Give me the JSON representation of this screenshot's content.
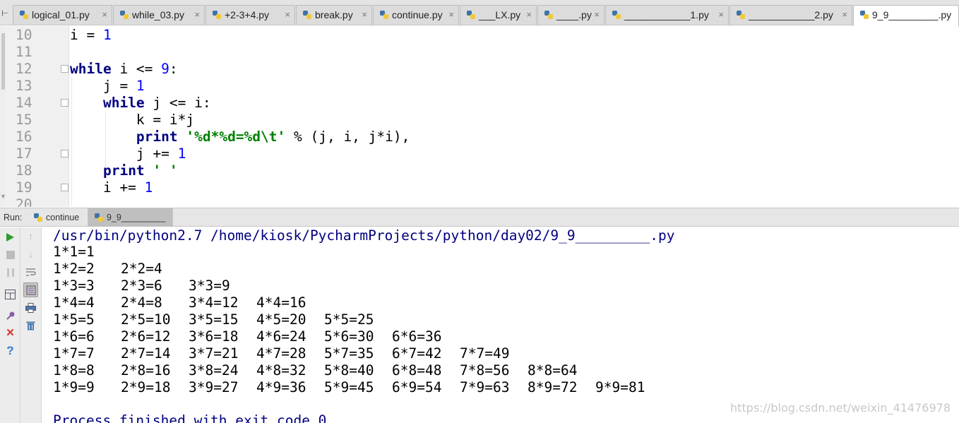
{
  "editor_tabs": [
    {
      "label": "logical_01.py"
    },
    {
      "label": "while_03.py"
    },
    {
      "label": "+2-3+4.py"
    },
    {
      "label": "break.py"
    },
    {
      "label": "continue.py"
    },
    {
      "label": "___LX.py"
    },
    {
      "label": "____.py"
    },
    {
      "label": "____________1.py"
    },
    {
      "label": "____________2.py"
    },
    {
      "label": "9_9_________.py",
      "active": true
    }
  ],
  "tab_close_glyph": "×",
  "code_lines": [
    {
      "num": "10",
      "text": "i = 1"
    },
    {
      "num": "11",
      "text": ""
    },
    {
      "num": "12",
      "text": "while i <= 9:"
    },
    {
      "num": "13",
      "text": "    j = 1"
    },
    {
      "num": "14",
      "text": "    while j <= i:"
    },
    {
      "num": "15",
      "text": "        k = i*j"
    },
    {
      "num": "16",
      "text": "        print '%d*%d=%d\\t' % (j, i, j*i),"
    },
    {
      "num": "17",
      "text": "        j += 1"
    },
    {
      "num": "18",
      "text": "    print ' '"
    },
    {
      "num": "19",
      "text": "    i += 1"
    },
    {
      "num": "20",
      "text": ""
    }
  ],
  "run_panel": {
    "label": "Run:",
    "tabs": [
      {
        "label": "continue",
        "active": false
      },
      {
        "label": "9_9_________",
        "active": true
      }
    ]
  },
  "console": {
    "command": "/usr/bin/python2.7 /home/kiosk/PycharmProjects/python/day02/9_9_________.py",
    "table_rows": [
      [
        "1*1=1"
      ],
      [
        "1*2=2",
        "2*2=4"
      ],
      [
        "1*3=3",
        "2*3=6",
        "3*3=9"
      ],
      [
        "1*4=4",
        "2*4=8",
        "3*4=12",
        "4*4=16"
      ],
      [
        "1*5=5",
        "2*5=10",
        "3*5=15",
        "4*5=20",
        "5*5=25"
      ],
      [
        "1*6=6",
        "2*6=12",
        "3*6=18",
        "4*6=24",
        "5*6=30",
        "6*6=36"
      ],
      [
        "1*7=7",
        "2*7=14",
        "3*7=21",
        "4*7=28",
        "5*7=35",
        "6*7=42",
        "7*7=49"
      ],
      [
        "1*8=8",
        "2*8=16",
        "3*8=24",
        "4*8=32",
        "5*8=40",
        "6*8=48",
        "7*8=56",
        "8*8=64"
      ],
      [
        "1*9=9",
        "2*9=18",
        "3*9=27",
        "4*9=36",
        "5*9=45",
        "6*9=54",
        "7*9=63",
        "8*9=72",
        "9*9=81"
      ]
    ],
    "exit_message": "Process finished with exit code 0"
  },
  "watermark": "https://blog.csdn.net/weixin_41476978",
  "colors": {
    "keyword": "#000080",
    "number": "#0000ff",
    "string": "#008000",
    "run_green": "#2e9b2e",
    "close_red": "#d9302a",
    "help_blue": "#2b7bd6"
  }
}
